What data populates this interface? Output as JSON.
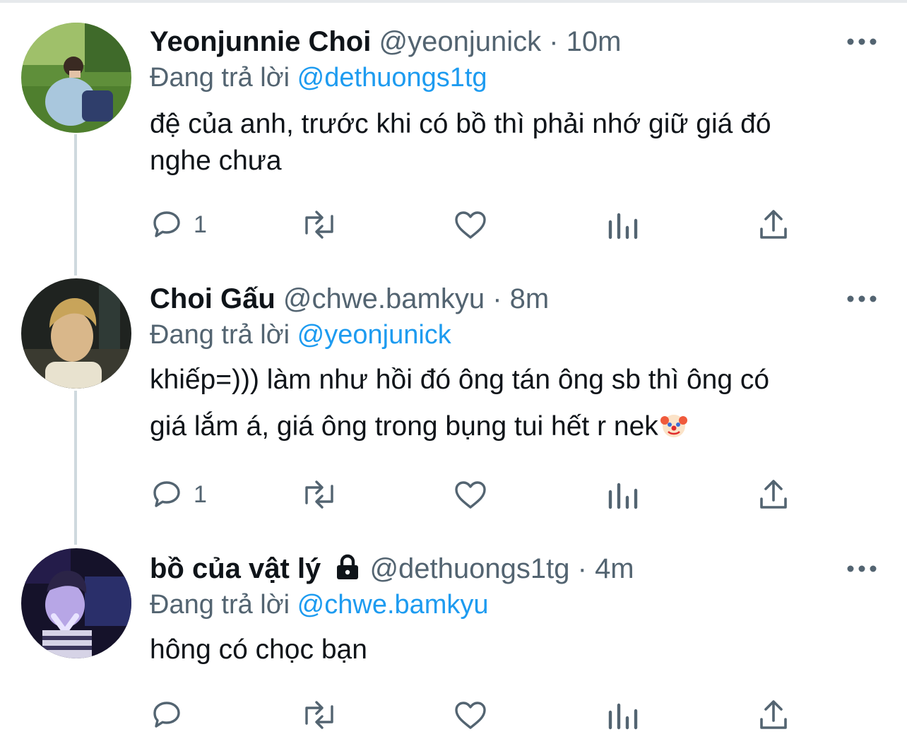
{
  "reply_prefix": "Đang trả lời",
  "tweets": [
    {
      "name": "Yeonjunnie Choi",
      "handle": "@yeonjunick",
      "separator": "·",
      "time": "10m",
      "reply_to": "@dethuongs1tg",
      "text_lines": [
        "đệ của anh, trước khi có bồ thì phải nhớ giữ giá đó",
        "nghe chưa"
      ],
      "reply_count": "1",
      "locked": false
    },
    {
      "name": "Choi Gấu",
      "handle": "@chwe.bamkyu",
      "separator": "·",
      "time": "8m",
      "reply_to": "@yeonjunick",
      "text_lines": [
        "khiếp=))) làm như hồi đó ông tán ông sb thì ông có",
        "giá lắm á, giá ông trong bụng tui hết r nek"
      ],
      "trailing_emoji": "clown-face-emoji",
      "reply_count": "1",
      "locked": false
    },
    {
      "name": "bồ của vật lý",
      "handle": "@dethuongs1tg",
      "separator": "·",
      "time": "4m",
      "reply_to": "@chwe.bamkyu",
      "text_lines": [
        "hông có chọc bạn"
      ],
      "reply_count": "",
      "locked": true
    }
  ],
  "icons": [
    "reply-icon",
    "retweet-icon",
    "like-icon",
    "analytics-icon",
    "share-icon",
    "more-icon",
    "lock-icon"
  ],
  "colors": {
    "link": "#1d9bf0",
    "muted": "#536471",
    "text": "#0f1419",
    "thread_line": "#cfd9de"
  }
}
